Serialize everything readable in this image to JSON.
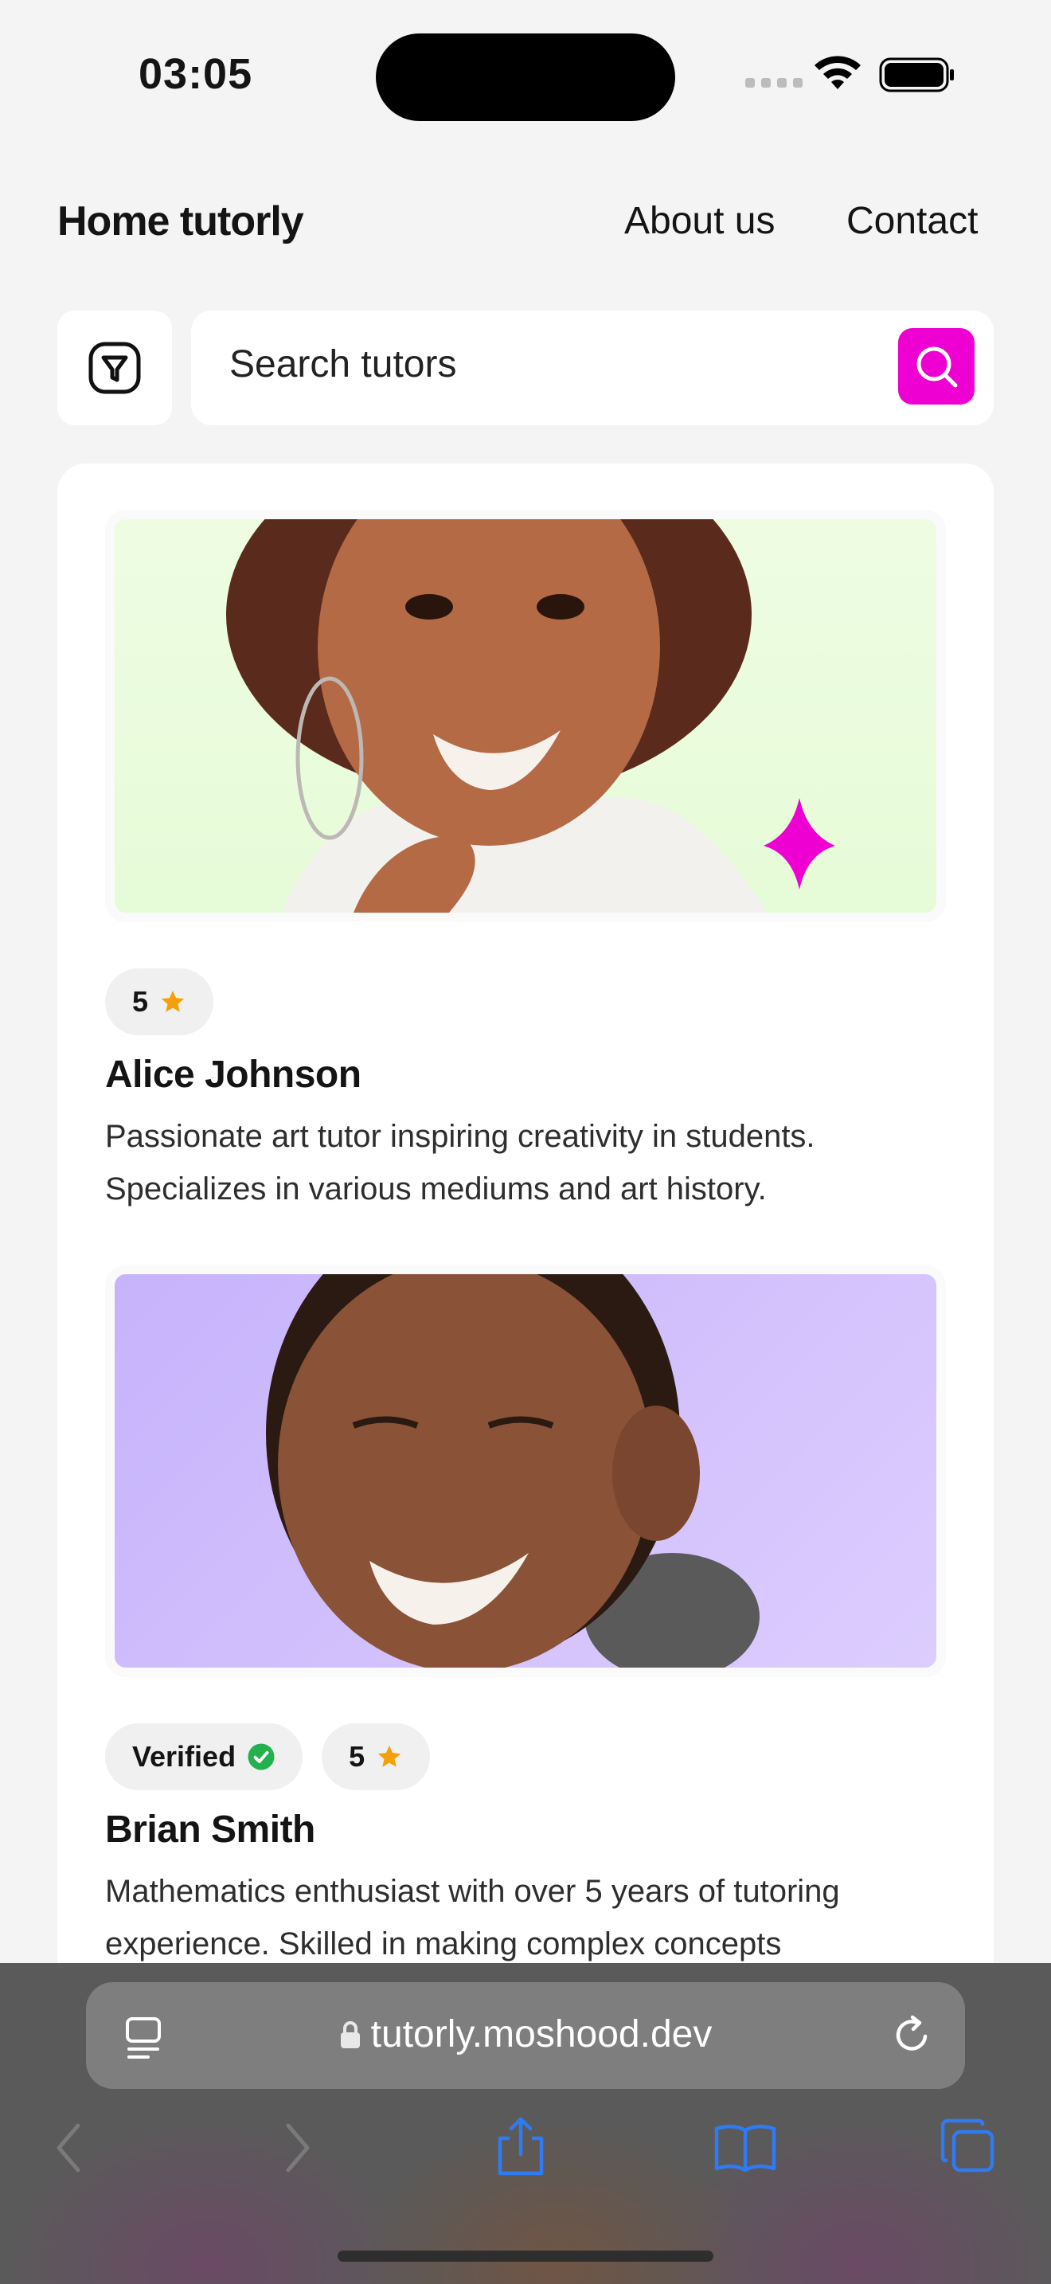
{
  "status": {
    "time": "03:05"
  },
  "nav": {
    "brand": "Home tutorly",
    "about": "About us",
    "contact": "Contact"
  },
  "search": {
    "placeholder": "Search tutors"
  },
  "tutors": [
    {
      "name": "Alice Johnson",
      "rating": "5",
      "bio": "Passionate art tutor inspiring creativity in students. Specializes in various mediums and art history."
    },
    {
      "name": "Brian Smith",
      "verified": "Verified",
      "rating": "5",
      "bio": "Mathematics enthusiast with over 5 years of tutoring experience. Skilled in making complex concepts"
    }
  ],
  "browser": {
    "url": "tutorly.moshood.dev"
  },
  "colors": {
    "accent": "#ee00d2",
    "star": "#f5a00a",
    "verified": "#22b14c"
  }
}
